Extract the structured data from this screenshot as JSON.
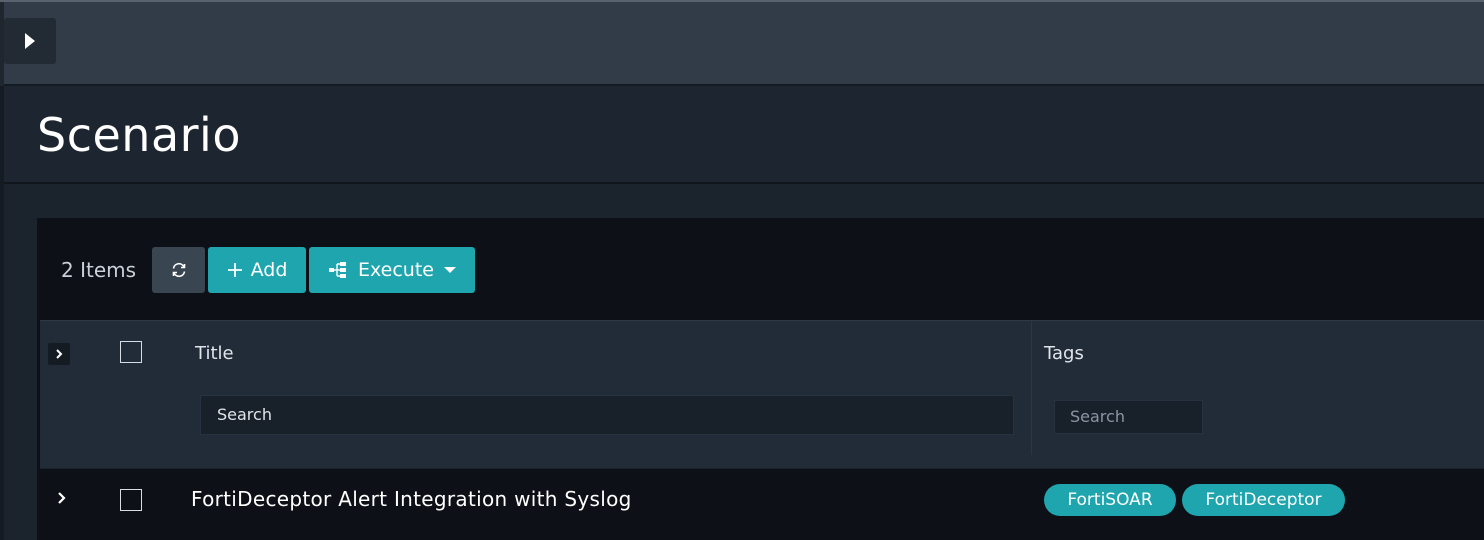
{
  "header": {
    "title": "Scenario"
  },
  "toolbar": {
    "items_count": "2 Items",
    "add_label": "Add",
    "execute_label": "Execute"
  },
  "table": {
    "columns": [
      "Title",
      "Tags"
    ],
    "search": {
      "title_value": "Search",
      "tags_placeholder": "Search"
    },
    "rows": [
      {
        "title": "FortiDeceptor Alert Integration with Syslog",
        "tags": [
          "FortiSOAR",
          "FortiDeceptor"
        ]
      }
    ]
  },
  "colors": {
    "accent": "#1ea5ad",
    "topbar": "#323c48",
    "panel": "#0d1117"
  },
  "icons": [
    "sidebar-toggle-icon",
    "refresh-icon",
    "plus-icon",
    "playbook-icon",
    "caret-down-icon",
    "chevron-right-icon"
  ]
}
